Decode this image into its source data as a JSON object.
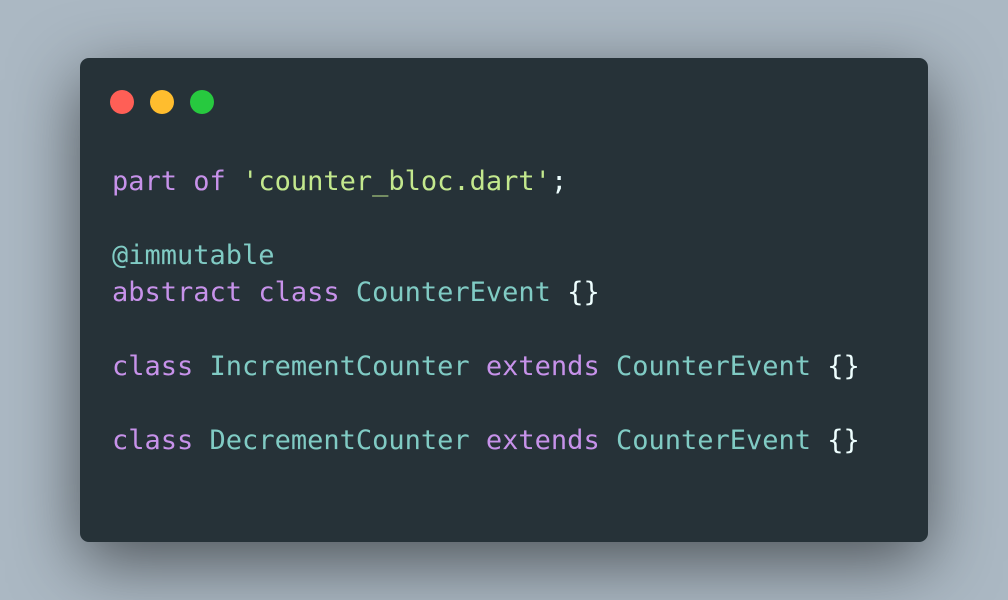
{
  "window": {
    "controls": [
      {
        "name": "close-dot",
        "color": "#ff5f56"
      },
      {
        "name": "minimize-dot",
        "color": "#ffbd2e"
      },
      {
        "name": "maximize-dot",
        "color": "#27c93f"
      }
    ]
  },
  "colors": {
    "keyword": "#c792ea",
    "string": "#c3e88d",
    "type": "#80cbc4",
    "punctuation": "#eeffff"
  },
  "code": {
    "lines": [
      [
        {
          "text": "part",
          "kind": "keyword"
        },
        {
          "text": " ",
          "kind": "punctuation"
        },
        {
          "text": "of",
          "kind": "keyword"
        },
        {
          "text": " ",
          "kind": "punctuation"
        },
        {
          "text": "'counter_bloc.dart'",
          "kind": "string"
        },
        {
          "text": ";",
          "kind": "punctuation"
        }
      ],
      [],
      [
        {
          "text": "@immutable",
          "kind": "type"
        }
      ],
      [
        {
          "text": "abstract",
          "kind": "keyword"
        },
        {
          "text": " ",
          "kind": "punctuation"
        },
        {
          "text": "class",
          "kind": "keyword"
        },
        {
          "text": " ",
          "kind": "punctuation"
        },
        {
          "text": "CounterEvent",
          "kind": "type"
        },
        {
          "text": " {}",
          "kind": "punctuation"
        }
      ],
      [],
      [
        {
          "text": "class",
          "kind": "keyword"
        },
        {
          "text": " ",
          "kind": "punctuation"
        },
        {
          "text": "IncrementCounter",
          "kind": "type"
        },
        {
          "text": " ",
          "kind": "punctuation"
        },
        {
          "text": "extends",
          "kind": "keyword"
        },
        {
          "text": " ",
          "kind": "punctuation"
        },
        {
          "text": "CounterEvent",
          "kind": "type"
        },
        {
          "text": " {}",
          "kind": "punctuation"
        }
      ],
      [],
      [
        {
          "text": "class",
          "kind": "keyword"
        },
        {
          "text": " ",
          "kind": "punctuation"
        },
        {
          "text": "DecrementCounter",
          "kind": "type"
        },
        {
          "text": " ",
          "kind": "punctuation"
        },
        {
          "text": "extends",
          "kind": "keyword"
        },
        {
          "text": " ",
          "kind": "punctuation"
        },
        {
          "text": "CounterEvent",
          "kind": "type"
        },
        {
          "text": " {}",
          "kind": "punctuation"
        }
      ]
    ]
  }
}
